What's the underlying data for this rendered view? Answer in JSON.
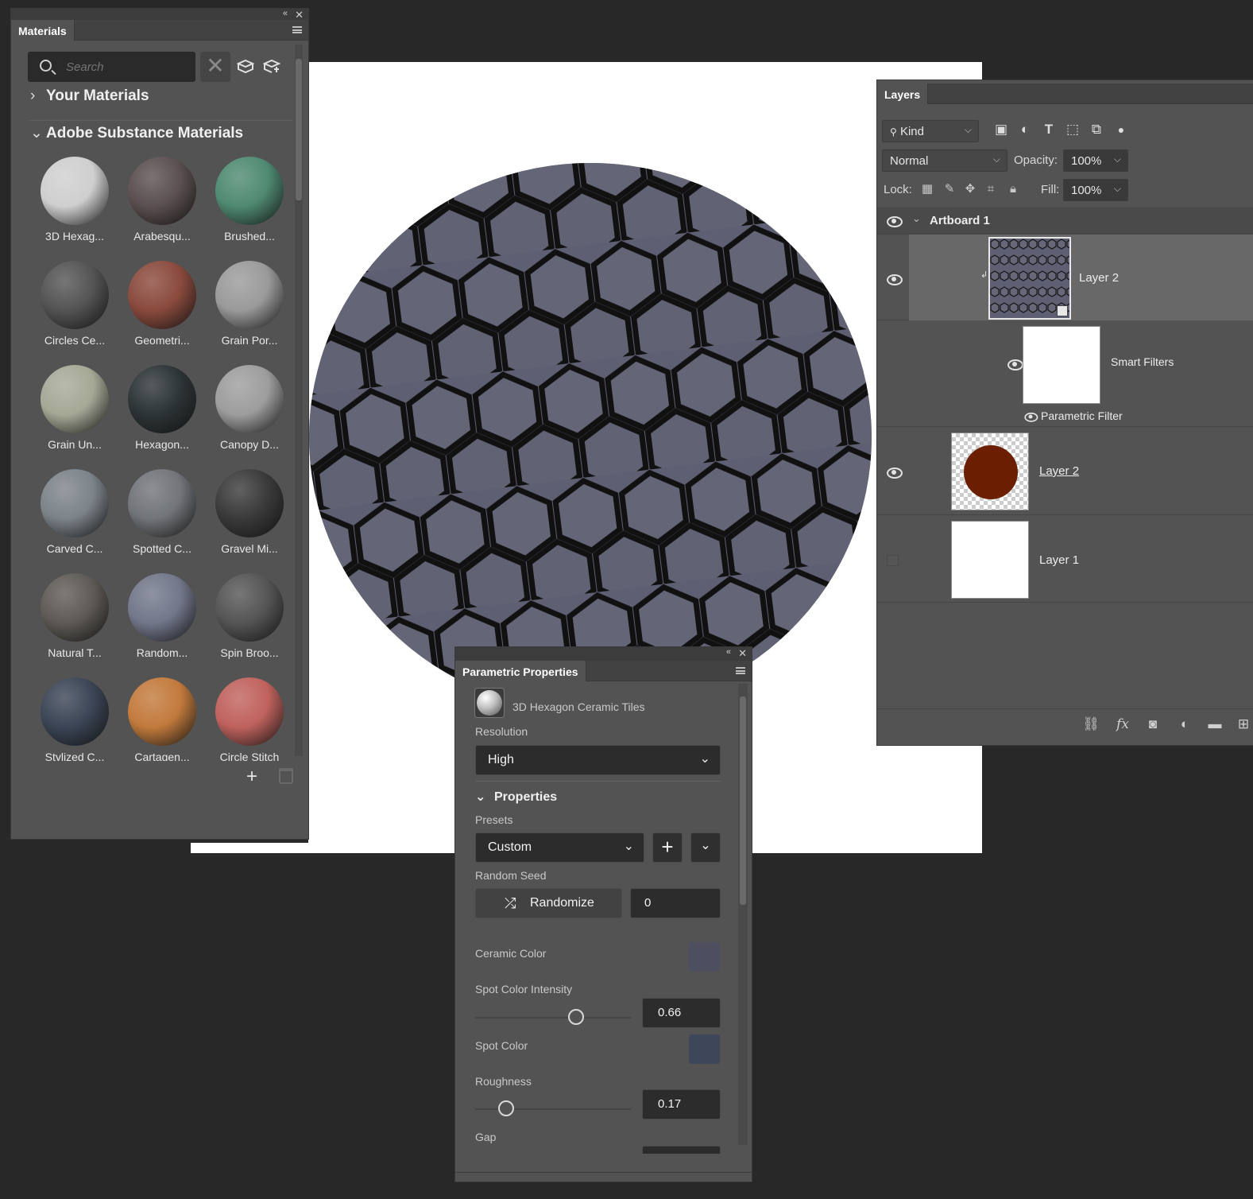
{
  "materials": {
    "tab": "Materials",
    "search_placeholder": "Search",
    "your_materials": "Your Materials",
    "adobe_materials": "Adobe Substance Materials",
    "items": [
      {
        "label": "3D Hexag...",
        "color": "#cfcfcf"
      },
      {
        "label": "Arabesqu...",
        "color": "#5b4f50"
      },
      {
        "label": "Brushed...",
        "color": "#4f8a72"
      },
      {
        "label": "Circles Ce...",
        "color": "#545454"
      },
      {
        "label": "Geometri...",
        "color": "#8a4a3d"
      },
      {
        "label": "Grain Por...",
        "color": "#9a9a9a"
      },
      {
        "label": "Grain Un...",
        "color": "#a6a896"
      },
      {
        "label": "Hexagon...",
        "color": "#2d3436"
      },
      {
        "label": "Canopy D...",
        "color": "#9d9d9d"
      },
      {
        "label": "Carved C...",
        "color": "#7c8389"
      },
      {
        "label": "Spotted C...",
        "color": "#717478"
      },
      {
        "label": "Gravel Mi...",
        "color": "#3a3a3a"
      },
      {
        "label": "Natural T...",
        "color": "#5e5a55"
      },
      {
        "label": "Random...",
        "color": "#72778a"
      },
      {
        "label": "Spin Broo...",
        "color": "#555555"
      },
      {
        "label": "Stylized C...",
        "color": "#3b4555"
      },
      {
        "label": "Cartagen...",
        "color": "#c27a3c"
      },
      {
        "label": "Circle Stitch",
        "color": "#c0625d"
      }
    ]
  },
  "layers": {
    "tab": "Layers",
    "kind_filter": "Kind",
    "blend_mode": "Normal",
    "opacity_label": "Opacity:",
    "opacity_value": "100%",
    "lock_label": "Lock:",
    "fill_label": "Fill:",
    "fill_value": "100%",
    "artboard": "Artboard 1",
    "rows": [
      {
        "name": "Layer 2"
      },
      {
        "name": "Smart Filters"
      },
      {
        "name": "Parametric Filter"
      },
      {
        "name": "Layer 2"
      },
      {
        "name": "Layer 1"
      }
    ],
    "circle_color": "#6b1f00"
  },
  "params": {
    "tab": "Parametric Properties",
    "material_name": "3D Hexagon Ceramic Tiles",
    "resolution_label": "Resolution",
    "resolution_value": "High",
    "properties_label": "Properties",
    "presets_label": "Presets",
    "presets_value": "Custom",
    "random_seed_label": "Random Seed",
    "randomize_label": "Randomize",
    "seed_value": "0",
    "ceramic_color_label": "Ceramic Color",
    "ceramic_color": "#4d4f61",
    "spot_intensity_label": "Spot Color Intensity",
    "spot_intensity_value": "0.66",
    "spot_color_label": "Spot Color",
    "spot_color": "#3e4659",
    "roughness_label": "Roughness",
    "roughness_value": "0.17",
    "gap_label": "Gap"
  }
}
